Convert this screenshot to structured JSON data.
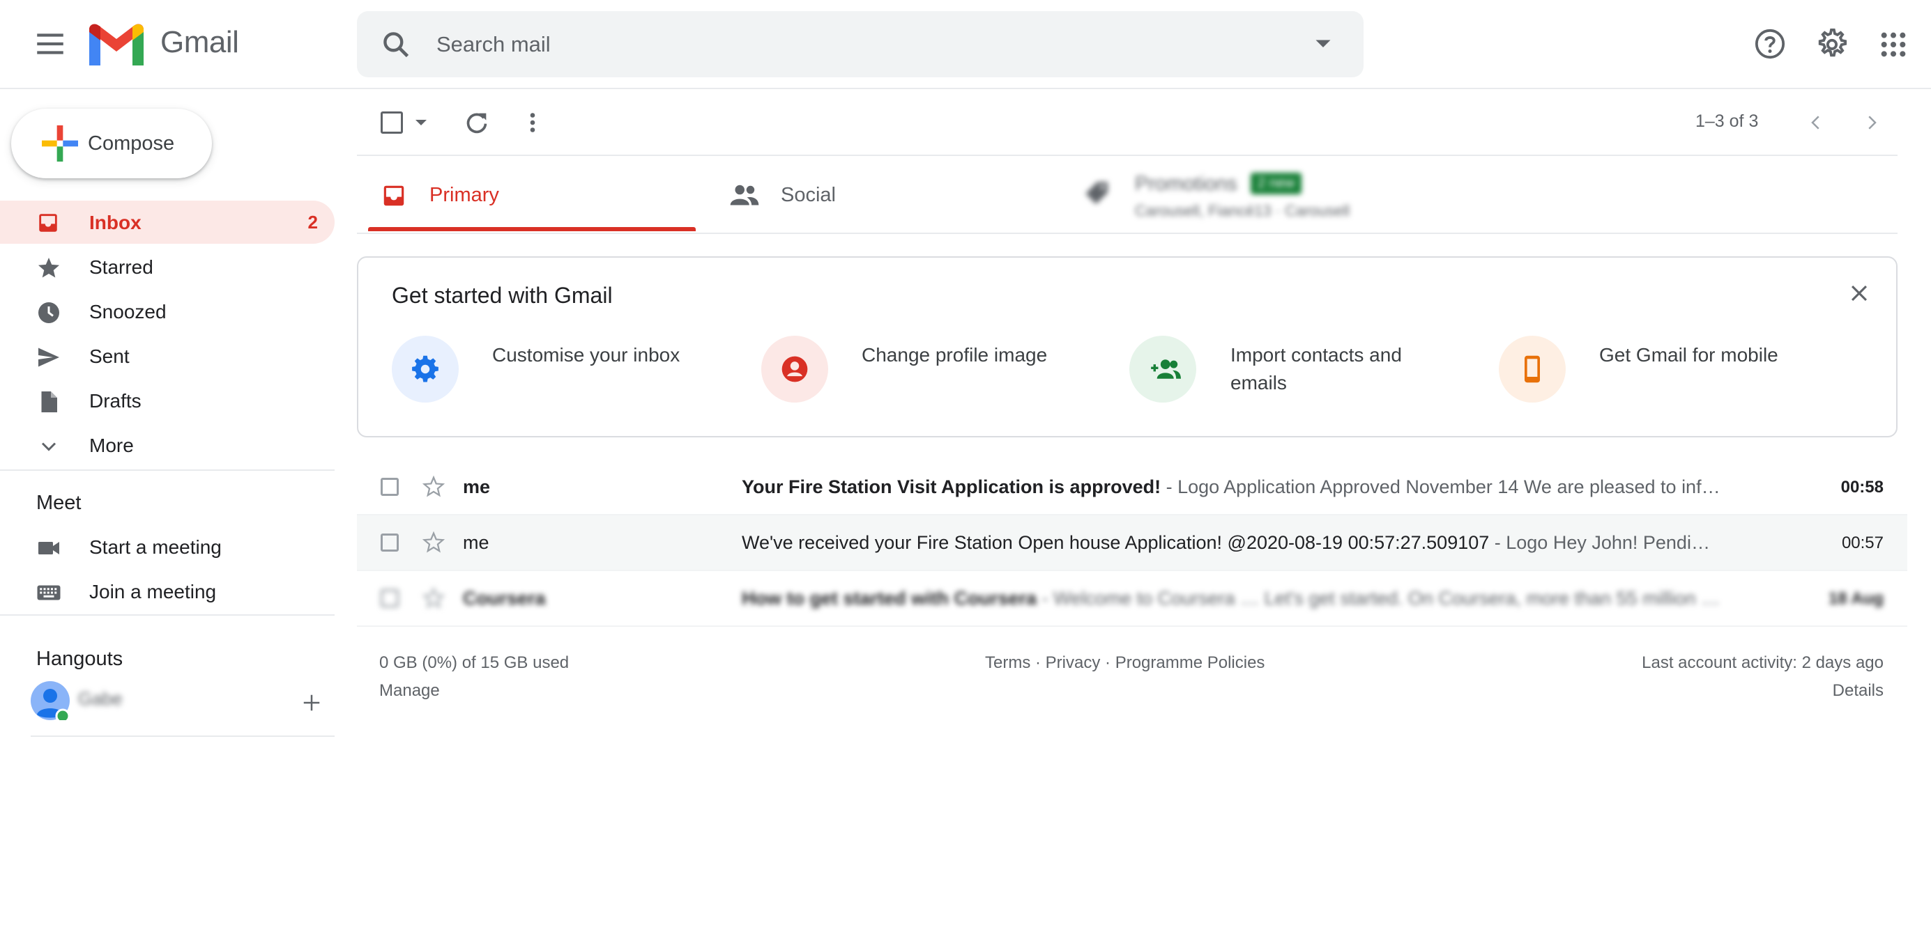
{
  "app": {
    "logo_text": "Gmail",
    "brand_colors": {
      "red": "#ea4335",
      "blue": "#4285f4",
      "green": "#34a853",
      "yellow": "#fbbc04",
      "active_red": "#d93025"
    }
  },
  "search": {
    "placeholder": "Search mail",
    "value": ""
  },
  "compose": {
    "label": "Compose"
  },
  "sidebar": {
    "items": [
      {
        "label": "Inbox",
        "count": "2",
        "icon": "inbox-icon",
        "active": true
      },
      {
        "label": "Starred",
        "icon": "star-icon"
      },
      {
        "label": "Snoozed",
        "icon": "clock-icon"
      },
      {
        "label": "Sent",
        "icon": "send-icon"
      },
      {
        "label": "Drafts",
        "icon": "draft-icon"
      },
      {
        "label": "More",
        "icon": "chevron-down-icon"
      }
    ],
    "meet": {
      "title": "Meet",
      "items": [
        {
          "label": "Start a meeting",
          "icon": "video-icon"
        },
        {
          "label": "Join a meeting",
          "icon": "keyboard-icon"
        }
      ]
    },
    "hangouts": {
      "title": "Hangouts",
      "user": "Gabe"
    }
  },
  "toolbar": {
    "pagination": "1–3 of 3"
  },
  "tabs": [
    {
      "label": "Primary",
      "icon": "inbox-tab-icon",
      "active": true
    },
    {
      "label": "Social",
      "icon": "people-icon"
    },
    {
      "label": "Promotions",
      "badge": "2 new",
      "sub": "Carousell, Fiancé13 · Carousell",
      "icon": "tag-icon"
    }
  ],
  "get_started": {
    "title": "Get started with Gmail",
    "items": [
      {
        "label": "Customise your inbox",
        "icon": "gear-icon",
        "color": "#1a73e8",
        "bg": "#e8f0fe"
      },
      {
        "label": "Change profile image",
        "icon": "account-icon",
        "color": "#d93025",
        "bg": "#fce8e6"
      },
      {
        "label": "Import contacts and emails",
        "icon": "add-people-icon",
        "color": "#188038",
        "bg": "#e6f4ea"
      },
      {
        "label": "Get Gmail for mobile",
        "icon": "phone-icon",
        "color": "#e8710a",
        "bg": "#feefe3"
      }
    ]
  },
  "emails": [
    {
      "sender": "me",
      "subject": "Your Fire Station Visit Application is approved!",
      "snippet": " - Logo Application Approved November 14 We are pleased to inf…",
      "time": "00:58",
      "unread": true
    },
    {
      "sender": "me",
      "subject": "We've received your Fire Station Open house Application! @2020-08-19 00:57:27.509107",
      "snippet": " - Logo Hey John! Pendi…",
      "time": "00:57",
      "unread": false
    },
    {
      "sender": "Coursera",
      "subject": "How to get started with Coursera",
      "snippet": " - Welcome to Coursera … Let's get started. On Coursera, more than 55 million …",
      "time": "18 Aug",
      "unread": true
    }
  ],
  "footer": {
    "storage": "0 GB (0%) of 15 GB used",
    "manage": "Manage",
    "terms": "Terms",
    "privacy": "Privacy",
    "policies": "Programme Policies",
    "sep": " · ",
    "activity": "Last account activity: 2 days ago",
    "details": "Details"
  }
}
